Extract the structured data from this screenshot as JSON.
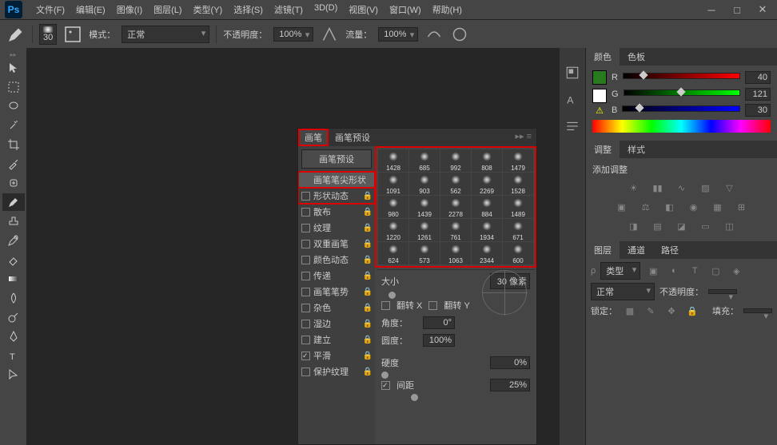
{
  "menu": [
    "文件(F)",
    "编辑(E)",
    "图像(I)",
    "图层(L)",
    "类型(Y)",
    "选择(S)",
    "滤镜(T)",
    "3D(D)",
    "视图(V)",
    "窗口(W)",
    "帮助(H)"
  ],
  "opt": {
    "brush_size": "30",
    "mode_label": "模式：",
    "mode_value": "正常",
    "opacity_label": "不透明度：",
    "opacity_value": "100%",
    "flow_label": "流量：",
    "flow_value": "100%"
  },
  "color": {
    "tab1": "颜色",
    "tab2": "色板",
    "r": "R",
    "g": "G",
    "b": "B",
    "rv": "40",
    "gv": "121",
    "bv": "30",
    "swatch": "#287a1e"
  },
  "adjust": {
    "tab1": "调整",
    "tab2": "样式",
    "title": "添加调整"
  },
  "layers": {
    "tab1": "图层",
    "tab2": "通道",
    "tab3": "路径",
    "kind": "类型",
    "blend": "正常",
    "opac_label": "不透明度：",
    "lock": "锁定：",
    "fill": "填充："
  },
  "brushPanel": {
    "tab1": "画笔",
    "tab2": "画笔预设",
    "preset_btn": "画笔预设",
    "opts": [
      "画笔笔尖形状",
      "形状动态",
      "散布",
      "纹理",
      "双重画笔",
      "颜色动态",
      "传递",
      "画笔笔势",
      "杂色",
      "湿边",
      "建立",
      "平滑",
      "保护纹理"
    ],
    "brushes": [
      1428,
      685,
      992,
      808,
      1479,
      1091,
      903,
      562,
      2269,
      1528,
      980,
      1439,
      2278,
      884,
      1489,
      1220,
      1261,
      761,
      1934,
      671,
      624,
      573,
      1063,
      2344,
      600
    ],
    "size_label": "大小",
    "size_value": "30 像素",
    "flipx": "翻转 X",
    "flipy": "翻转 Y",
    "angle_label": "角度：",
    "angle_value": "0°",
    "round_label": "圆度：",
    "round_value": "100%",
    "hard_label": "硬度",
    "hard_value": "0%",
    "spacing_label": "间距",
    "spacing_value": "25%"
  }
}
